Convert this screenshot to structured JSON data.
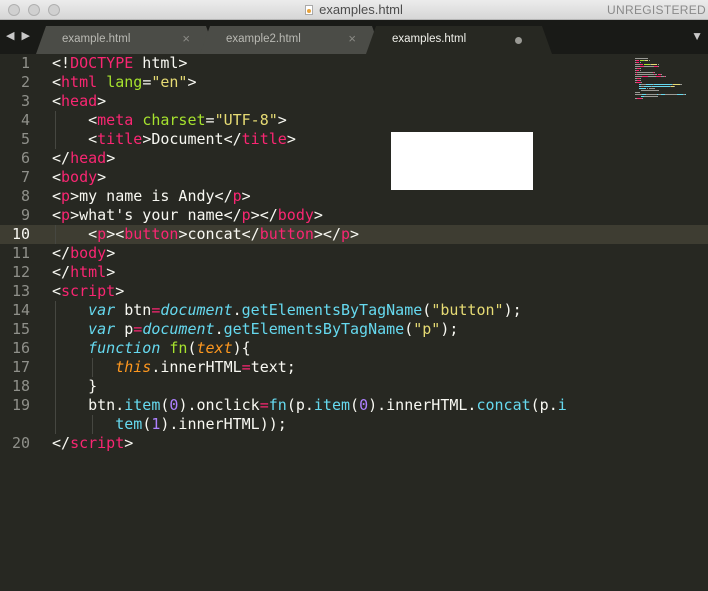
{
  "window": {
    "title": "examples.html",
    "license_status": "UNREGISTERED"
  },
  "tabs": [
    {
      "label": "example.html",
      "close": "×",
      "active": false
    },
    {
      "label": "example2.html",
      "close": "×",
      "active": false
    },
    {
      "label": "examples.html",
      "active": true,
      "modified": true
    }
  ],
  "nav": {
    "arrows": "◀ ▶",
    "dropdown": "▼"
  },
  "editor": {
    "current_line": 10,
    "line_numbers": [
      "1",
      "2",
      "3",
      "4",
      "5",
      "6",
      "7",
      "8",
      "9",
      "10",
      "11",
      "12",
      "13",
      "14",
      "15",
      "16",
      "17",
      "18",
      "19",
      "",
      "20"
    ],
    "lines": [
      [
        [
          "p",
          "<!"
        ],
        [
          "dt",
          "DOCTYPE"
        ],
        [
          "p",
          " html>"
        ]
      ],
      [
        [
          "p",
          "<"
        ],
        [
          "tg",
          "html"
        ],
        [
          "p",
          " "
        ],
        [
          "at",
          "lang"
        ],
        [
          "p",
          "="
        ],
        [
          "st",
          "\"en\""
        ],
        [
          "p",
          ">"
        ]
      ],
      [
        [
          "p",
          "<"
        ],
        [
          "tg",
          "head"
        ],
        [
          "p",
          ">"
        ]
      ],
      [
        [
          "p",
          "    <"
        ],
        [
          "tg",
          "meta"
        ],
        [
          "p",
          " "
        ],
        [
          "at",
          "charset"
        ],
        [
          "p",
          "="
        ],
        [
          "st",
          "\"UTF-8\""
        ],
        [
          "p",
          ">"
        ]
      ],
      [
        [
          "p",
          "    <"
        ],
        [
          "tg",
          "title"
        ],
        [
          "p",
          ">Document</"
        ],
        [
          "tg",
          "title"
        ],
        [
          "p",
          ">"
        ]
      ],
      [
        [
          "p",
          "</"
        ],
        [
          "tg",
          "head"
        ],
        [
          "p",
          ">"
        ]
      ],
      [
        [
          "p",
          "<"
        ],
        [
          "tg",
          "body"
        ],
        [
          "p",
          ">"
        ]
      ],
      [
        [
          "p",
          "<"
        ],
        [
          "tg",
          "p"
        ],
        [
          "p",
          ">my name is Andy</"
        ],
        [
          "tg",
          "p"
        ],
        [
          "p",
          ">"
        ]
      ],
      [
        [
          "p",
          "<"
        ],
        [
          "tg",
          "p"
        ],
        [
          "p",
          ">what's your name</"
        ],
        [
          "tg",
          "p"
        ],
        [
          "p",
          "></"
        ],
        [
          "tg",
          "body"
        ],
        [
          "p",
          ">"
        ]
      ],
      [
        [
          "p",
          "    <"
        ],
        [
          "tg",
          "p"
        ],
        [
          "p",
          "><"
        ],
        [
          "tg",
          "button"
        ],
        [
          "p",
          ">concat</"
        ],
        [
          "tg",
          "button"
        ],
        [
          "p",
          "></"
        ],
        [
          "tg",
          "p"
        ],
        [
          "p",
          ">"
        ]
      ],
      [
        [
          "p",
          "</"
        ],
        [
          "tg",
          "body"
        ],
        [
          "p",
          ">"
        ]
      ],
      [
        [
          "p",
          "</"
        ],
        [
          "tg",
          "html"
        ],
        [
          "p",
          ">"
        ]
      ],
      [
        [
          "p",
          "<"
        ],
        [
          "tg",
          "script"
        ],
        [
          "p",
          ">"
        ]
      ],
      [
        [
          "p",
          "    "
        ],
        [
          "kw",
          "var"
        ],
        [
          "p",
          " btn"
        ],
        [
          "op",
          "="
        ],
        [
          "dc",
          "document"
        ],
        [
          "p",
          "."
        ],
        [
          "fn",
          "getElementsByTagName"
        ],
        [
          "p",
          "("
        ],
        [
          "st",
          "\"button\""
        ],
        [
          "p",
          ");"
        ]
      ],
      [
        [
          "p",
          "    "
        ],
        [
          "kw",
          "var"
        ],
        [
          "p",
          " p"
        ],
        [
          "op",
          "="
        ],
        [
          "dc",
          "document"
        ],
        [
          "p",
          "."
        ],
        [
          "fn",
          "getElementsByTagName"
        ],
        [
          "p",
          "("
        ],
        [
          "st",
          "\"p\""
        ],
        [
          "p",
          ");"
        ]
      ],
      [
        [
          "p",
          "    "
        ],
        [
          "kw",
          "function"
        ],
        [
          "p",
          " "
        ],
        [
          "fnd",
          "fn"
        ],
        [
          "p",
          "("
        ],
        [
          "pm",
          "text"
        ],
        [
          "p",
          "){"
        ]
      ],
      [
        [
          "p",
          "       "
        ],
        [
          "th",
          "this"
        ],
        [
          "p",
          ".innerHTML"
        ],
        [
          "op",
          "="
        ],
        [
          "p",
          "text;"
        ]
      ],
      [
        [
          "p",
          "    }"
        ]
      ],
      [
        [
          "p",
          "    btn."
        ],
        [
          "fn",
          "item"
        ],
        [
          "p",
          "("
        ],
        [
          "nu",
          "0"
        ],
        [
          "p",
          ").onclick"
        ],
        [
          "op",
          "="
        ],
        [
          "fn",
          "fn"
        ],
        [
          "p",
          "(p."
        ],
        [
          "fn",
          "item"
        ],
        [
          "p",
          "("
        ],
        [
          "nu",
          "0"
        ],
        [
          "p",
          ").innerHTML."
        ],
        [
          "fn",
          "concat"
        ],
        [
          "p",
          "(p."
        ],
        [
          "fn",
          "i"
        ]
      ],
      [
        [
          "p",
          "       "
        ],
        [
          "fn",
          "tem"
        ],
        [
          "p",
          "("
        ],
        [
          "nu",
          "1"
        ],
        [
          "p",
          ").innerHTML));"
        ]
      ],
      [
        [
          "p",
          "</"
        ],
        [
          "tg",
          "script"
        ],
        [
          "p",
          ">"
        ]
      ]
    ]
  },
  "colors": {
    "background": "#272822",
    "tag": "#f92672",
    "attribute": "#a6e22e",
    "string": "#e6db74",
    "keyword": "#66d9ef",
    "parameter": "#fd971f",
    "number": "#ae81ff",
    "plain": "#f8f8f2"
  }
}
